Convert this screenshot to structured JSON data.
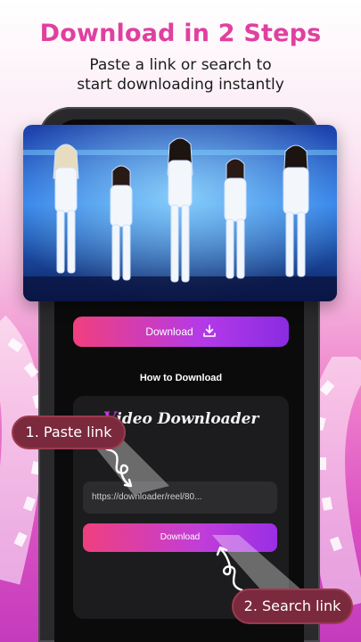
{
  "header": {
    "title": "Download in 2 Steps",
    "subtitle_line1": "Paste a link or search to",
    "subtitle_line2": "start downloading instantly"
  },
  "screen": {
    "download_button_label": "Download",
    "how_to_title": "How to Download",
    "brand_initial": "V",
    "brand_rest": "ideo Downloader",
    "url_value": "https://downloader/reel/80...",
    "bottom_download_label": "Download"
  },
  "callouts": {
    "step1": "1. Paste link",
    "step2": "2. Search link"
  },
  "colors": {
    "headline": "#e0409f",
    "button_start": "#f03f7e",
    "button_end": "#8a2be2",
    "callout_bg": "#7a2a3c"
  },
  "icons": {
    "download": "download-icon",
    "curly_arrow": "curly-arrow-icon"
  }
}
